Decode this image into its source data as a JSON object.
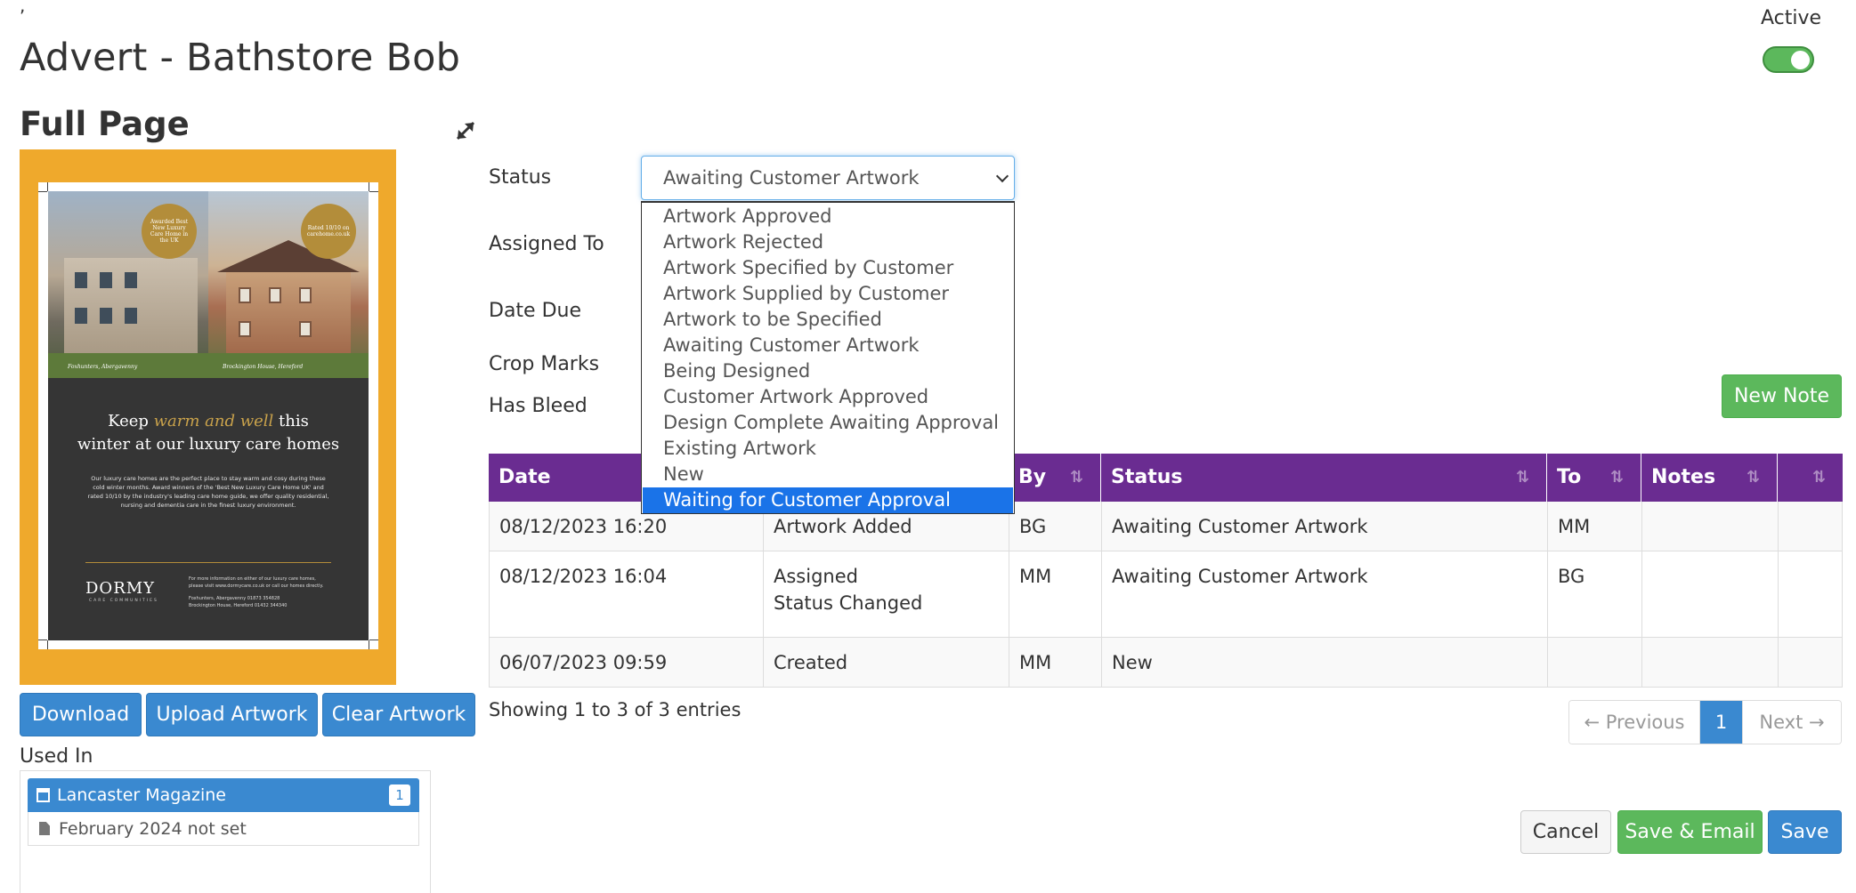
{
  "page": {
    "tick": ",",
    "title": "Advert - Bathstore Bob",
    "section_title": "Full Page",
    "active_label": "Active",
    "active_on": true
  },
  "icons": {
    "expand": "expand-icon",
    "calendar": "calendar-icon",
    "file": "file-icon",
    "sort": "sort-icon",
    "chevron": "chevron-down-icon"
  },
  "artwork": {
    "badge_left": "Awarded Best New Luxury Care Home in the UK",
    "badge_right": "Rated 10/10 on carehome.co.uk",
    "caption_left": "Foxhunters, Abergavenny",
    "caption_right": "Brockington House, Hereford",
    "headline_1": "Keep ",
    "headline_gold": "warm and well",
    "headline_2": " this",
    "headline_3": "winter at our luxury care homes",
    "body": "Our luxury care homes are the perfect place to stay warm and cosy during these cold winter months. Award winners of the 'Best New Luxury Care Home UK' and rated 10/10 by the industry's leading care home guide, we offer quality residential, nursing and dementia care in the finest luxury environment.",
    "logo": "DORMY",
    "logo_sub": "CARE COMMUNITIES",
    "contact_1": "For more information on either of our luxury care homes, please visit www.dormycare.co.uk or call our homes directly.",
    "contact_2": "Foxhunters, Abergavenny 01873 354828",
    "contact_3": "Brockington House, Hereford 01432 344340"
  },
  "buttons": {
    "download": "Download",
    "upload": "Upload Artwork",
    "clear": "Clear Artwork",
    "new_note": "New Note",
    "cancel": "Cancel",
    "save_email": "Save & Email",
    "save": "Save"
  },
  "used_in": {
    "label": "Used In",
    "magazine": "Lancaster Magazine",
    "count": "1",
    "issue": "February 2024 not set"
  },
  "form": {
    "status_label": "Status",
    "assigned_label": "Assigned To",
    "date_due_label": "Date Due",
    "crop_marks_label": "Crop Marks",
    "has_bleed_label": "Has Bleed",
    "status_value": "Awaiting Customer Artwork",
    "options": [
      "Artwork Approved",
      "Artwork Rejected",
      "Artwork Specified by Customer",
      "Artwork Supplied by Customer",
      "Artwork to be Specified",
      "Awaiting Customer Artwork",
      "Being Designed",
      "Customer Artwork Approved",
      "Design Complete Awaiting Approval",
      "Existing Artwork",
      "New",
      "Waiting for Customer Approval"
    ],
    "highlighted_option": "Waiting for Customer Approval"
  },
  "table": {
    "columns": [
      "Date",
      "",
      "By",
      "Status",
      "To",
      "Notes",
      ""
    ],
    "rows": [
      {
        "date": "08/12/2023 16:20",
        "action": "Artwork Added",
        "action_2": "",
        "by": "BG",
        "status": "Awaiting Customer Artwork",
        "to": "MM",
        "notes": ""
      },
      {
        "date": "08/12/2023 16:04",
        "action": "Assigned",
        "action_2": "Status Changed",
        "by": "MM",
        "status": "Awaiting Customer Artwork",
        "to": "BG",
        "notes": ""
      },
      {
        "date": "06/07/2023 09:59",
        "action": "Created",
        "action_2": "",
        "by": "MM",
        "status": "New",
        "to": "",
        "notes": ""
      }
    ],
    "showing": "Showing 1 to 3 of 3 entries"
  },
  "pagination": {
    "previous": "← Previous",
    "current": "1",
    "next": "Next →"
  },
  "colors": {
    "primary": "#3a89d0",
    "success": "#5cb85c",
    "table_header": "#6a2c91",
    "artwork_bg": "#efa92c",
    "dropdown_highlight": "#1a73e8"
  }
}
